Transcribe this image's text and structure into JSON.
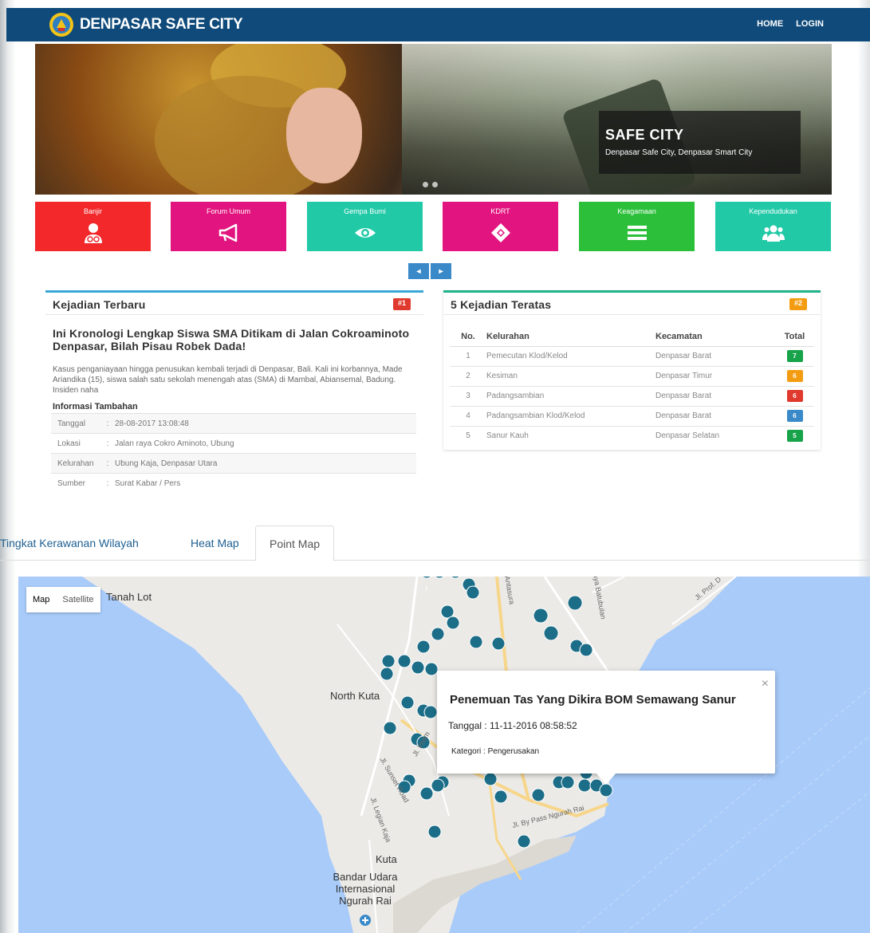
{
  "header": {
    "brand": "DENPASAR SAFE CITY",
    "nav": [
      "HOME",
      "LOGIN"
    ],
    "colors": {
      "bar": "#0f4a7a"
    }
  },
  "hero": {
    "title": "SAFE CITY",
    "subtitle": "Denpasar Safe City, Denpasar Smart City"
  },
  "categories": [
    {
      "label": "Banjir",
      "icon": "user-medical-icon",
      "color": "#f2282a"
    },
    {
      "label": "Forum Umum",
      "icon": "megaphone-icon",
      "color": "#e2147f"
    },
    {
      "label": "Gempa Bumi",
      "icon": "eye-icon",
      "color": "#21c9a7"
    },
    {
      "label": "KDRT",
      "icon": "ticket-icon",
      "color": "#e2147f"
    },
    {
      "label": "Keagamaan",
      "icon": "bars-icon",
      "color": "#2cbf3a"
    },
    {
      "label": "Kependudukan",
      "icon": "users-icon",
      "color": "#21c9a7"
    }
  ],
  "pager": {
    "prev": "◂",
    "next": "▸"
  },
  "latest": {
    "heading": "Kejadian Terbaru",
    "badge": "#1",
    "badge_color": "#e0392d",
    "title": "Ini Kronologi Lengkap Siswa SMA Ditikam di Jalan Cokroaminoto Denpasar, Bilah Pisau Robek Dada!",
    "body": "Kasus penganiayaan hingga penusukan kembali terjadi di Denpasar, Bali. Kali ini korbannya, Made Ariandika (15), siswa salah satu sekolah menengah atas (SMA) di Mambal, Abiansemal, Badung. Insiden naha",
    "extra_heading": "Informasi Tambahan",
    "info": [
      {
        "key": "Tanggal",
        "value": "28-08-2017 13:08:48"
      },
      {
        "key": "Lokasi",
        "value": "Jalan raya Cokro Aminoto, Ubung"
      },
      {
        "key": "Kelurahan",
        "value": "Ubung Kaja, Denpasar Utara"
      },
      {
        "key": "Sumber",
        "value": "Surat Kabar / Pers"
      }
    ]
  },
  "top5": {
    "heading": "5 Kejadian Teratas",
    "badge": "#2",
    "badge_color": "#f39c12",
    "columns": [
      "No.",
      "Kelurahan",
      "Kecamatan",
      "Total"
    ],
    "rows": [
      {
        "no": "1",
        "kelurahan": "Pemecutan Klod/Kelod",
        "kecamatan": "Denpasar Barat",
        "total": "7",
        "color": "#16a34a"
      },
      {
        "no": "2",
        "kelurahan": "Kesiman",
        "kecamatan": "Denpasar Timur",
        "total": "6",
        "color": "#f39c12"
      },
      {
        "no": "3",
        "kelurahan": "Padangsambian",
        "kecamatan": "Denpasar Barat",
        "total": "6",
        "color": "#e0392d"
      },
      {
        "no": "4",
        "kelurahan": "Padangsambian Klod/Kelod",
        "kecamatan": "Denpasar Barat",
        "total": "6",
        "color": "#3a89c9"
      },
      {
        "no": "5",
        "kelurahan": "Sanur Kauh",
        "kecamatan": "Denpasar Selatan",
        "total": "5",
        "color": "#16a34a"
      }
    ]
  },
  "tabs": [
    "Tingkat Kerawanan Wilayah",
    "Heat Map",
    "Point Map"
  ],
  "active_tab": "Point Map",
  "map": {
    "type_controls": [
      "Map",
      "Satellite"
    ],
    "labels": {
      "tanah_lot": "Tanah Lot",
      "north_kuta": "North Kuta",
      "kuta": "Kuta",
      "airport": "Bandar Udara\nInternasional\nNgurah Rai",
      "bypass": "Jl. By Pass Ngurah Rai",
      "legian": "Jl. Legian Kaja",
      "sunset": "Jl. Sunset Road",
      "imam": "Jl. Imam",
      "antasura": "Antasura",
      "batubulan": "aya Batubulan",
      "prof": "Jl. Prof. D"
    },
    "popup": {
      "title": "Penemuan Tas Yang Dikira BOM Semawang Sanur",
      "date_label": "Tanggal : 11-11-2016 08:58:52",
      "category_label": "Kategori : Pengerusakan",
      "close": "×"
    }
  }
}
